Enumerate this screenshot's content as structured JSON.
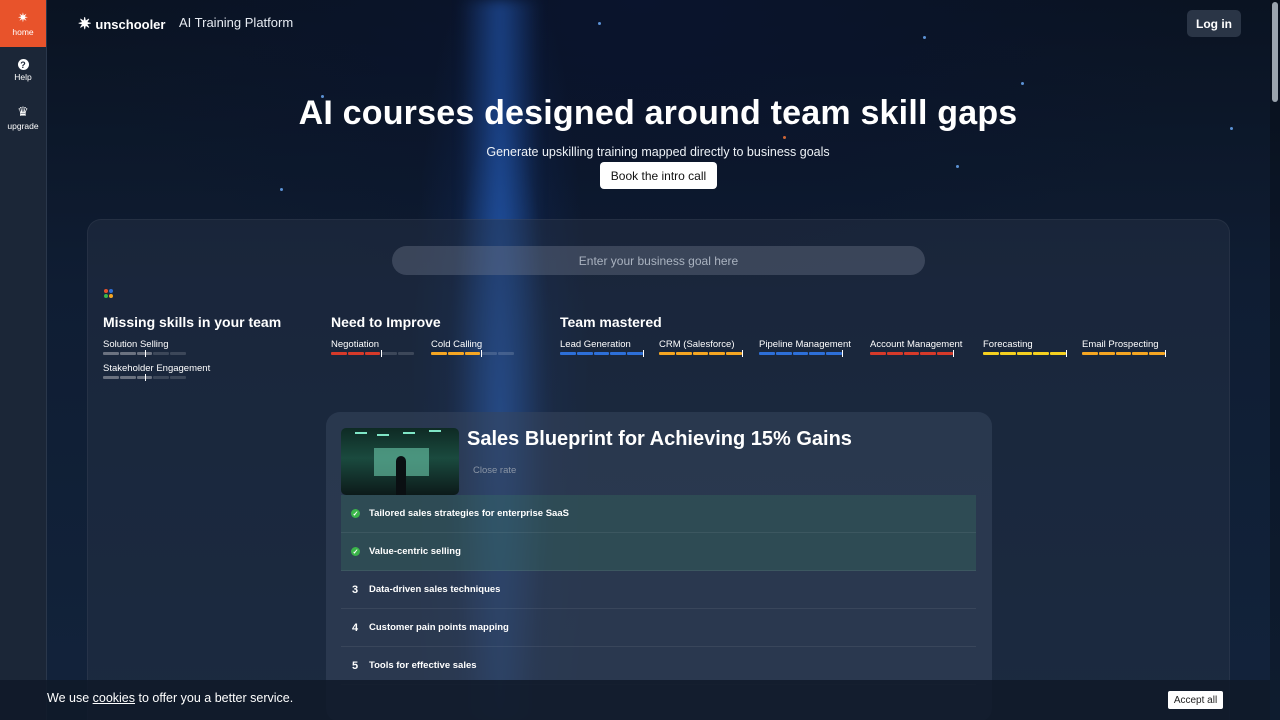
{
  "sidebar": {
    "items": [
      {
        "label": "home",
        "icon": "sparkle-icon",
        "active": true
      },
      {
        "label": "Help",
        "icon": "help-icon"
      },
      {
        "label": "upgrade",
        "icon": "crown-icon"
      }
    ]
  },
  "header": {
    "logo": "unschooler",
    "platform": "AI Training Platform",
    "login_label": "Log in"
  },
  "hero": {
    "title": "AI courses designed around team skill gaps",
    "subtitle": "Generate upskilling training mapped directly to business goals",
    "cta_label": "Book the intro call"
  },
  "goal_input": {
    "placeholder": "Enter your business goal here"
  },
  "skills": {
    "missing": {
      "title": "Missing skills in your team",
      "items": [
        {
          "name": "Solution Selling",
          "level": 0.5
        },
        {
          "name": "Stakeholder Engagement",
          "level": 0.5
        }
      ]
    },
    "improve": {
      "title": "Need to Improve",
      "items": [
        {
          "name": "Negotiation",
          "level": 0.6
        },
        {
          "name": "Cold Calling",
          "level": 0.6
        }
      ]
    },
    "mastered": {
      "title": "Team mastered",
      "items": [
        {
          "name": "Lead Generation",
          "level": 1.0
        },
        {
          "name": "CRM (Salesforce)",
          "level": 1.0
        },
        {
          "name": "Pipeline Management",
          "level": 1.0
        },
        {
          "name": "Account Management",
          "level": 1.0
        },
        {
          "name": "Forecasting",
          "level": 1.0
        },
        {
          "name": "Email Prospecting",
          "level": 1.0
        }
      ]
    }
  },
  "course": {
    "title": "Sales Blueprint for Achieving 15% Gains",
    "subtitle": "Close rate",
    "lessons": [
      {
        "num": "",
        "label": "Tailored sales strategies for enterprise SaaS",
        "done": true
      },
      {
        "num": "",
        "label": "Value-centric selling",
        "done": true
      },
      {
        "num": "3",
        "label": "Data-driven sales techniques",
        "done": false
      },
      {
        "num": "4",
        "label": "Customer pain points mapping",
        "done": false
      },
      {
        "num": "5",
        "label": "Tools for effective sales",
        "done": false
      }
    ]
  },
  "cookie": {
    "text_before": "We use ",
    "link": "cookies",
    "text_after": " to offer you a better service.",
    "accept_label": "Accept all"
  },
  "colors": {
    "accent": "#e8532b",
    "gray_bar": "#6b7280",
    "red_bar": "#d63a2a",
    "orange_bar": "#f5a623",
    "blue_bar": "#2d6fd8",
    "yellow_bar": "#f5d020",
    "check_green": "#3bb54a"
  }
}
